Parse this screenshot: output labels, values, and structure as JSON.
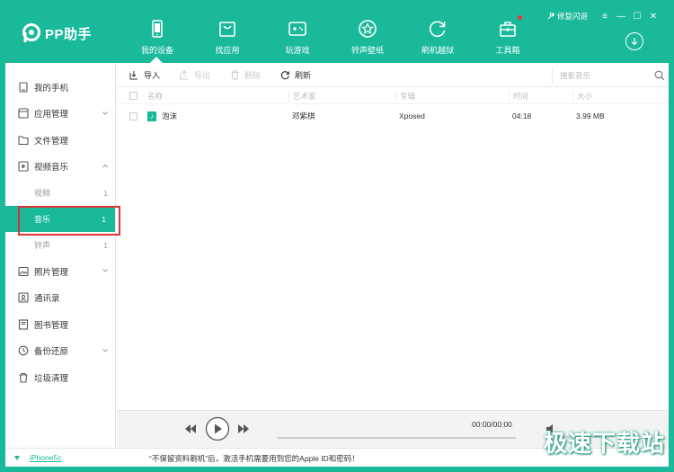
{
  "app": {
    "name": "PP助手",
    "accent_color": "#19b99a",
    "active_highlight_border": "#dd3333"
  },
  "header": {
    "nav": [
      {
        "label": "我的设备",
        "icon": "phone-icon",
        "active": true
      },
      {
        "label": "找应用",
        "icon": "shopping-bag-icon"
      },
      {
        "label": "玩游戏",
        "icon": "gamepad-icon"
      },
      {
        "label": "铃声壁纸",
        "icon": "star-badge-icon"
      },
      {
        "label": "刷机越狱",
        "icon": "refresh-icon"
      },
      {
        "label": "工具箱",
        "icon": "toolbox-icon",
        "has_badge": true
      }
    ],
    "repair_label": "修复闪退",
    "menu_icon": "hamburger-icon",
    "minimize_icon": "minimize-icon",
    "maximize_icon": "maximize-icon",
    "close_icon": "close-icon",
    "download_icon": "download-icon"
  },
  "sidebar": {
    "items": [
      {
        "label": "我的手机",
        "icon": "phone-outline-icon"
      },
      {
        "label": "应用管理",
        "icon": "apps-icon",
        "expandable": true
      },
      {
        "label": "文件管理",
        "icon": "folder-icon"
      },
      {
        "label": "视频音乐",
        "icon": "video-icon",
        "expandable": true,
        "expanded": true
      },
      {
        "label": "照片管理",
        "icon": "photo-icon",
        "expandable": true
      },
      {
        "label": "通讯录",
        "icon": "contacts-icon"
      },
      {
        "label": "图书管理",
        "icon": "book-icon"
      },
      {
        "label": "备份还原",
        "icon": "backup-icon",
        "expandable": true
      },
      {
        "label": "垃圾清理",
        "icon": "trash-icon"
      }
    ],
    "media_sub": [
      {
        "label": "视频",
        "count": "1"
      },
      {
        "label": "音乐",
        "count": "1",
        "active": true
      },
      {
        "label": "铃声",
        "count": "1"
      }
    ]
  },
  "toolbar": {
    "import_label": "导入",
    "export_label": "导出",
    "delete_label": "删除",
    "refresh_label": "刷新",
    "search_placeholder": "搜索音乐"
  },
  "table": {
    "headers": [
      "名称",
      "艺术家",
      "专辑",
      "时间",
      "大小"
    ],
    "rows": [
      {
        "name": "泡沫",
        "artist": "邓紫棋",
        "album": "Xposed",
        "time": "04:18",
        "size": "3.99 MB"
      }
    ]
  },
  "player": {
    "time": "00:00/00:00",
    "progress": 0,
    "volume": 0.6
  },
  "status": {
    "device": "iPhone5c",
    "notice": "“不保留资料刷机”后，激活手机需要用到您的Apple ID和密码！"
  },
  "watermark": "极速下载站"
}
